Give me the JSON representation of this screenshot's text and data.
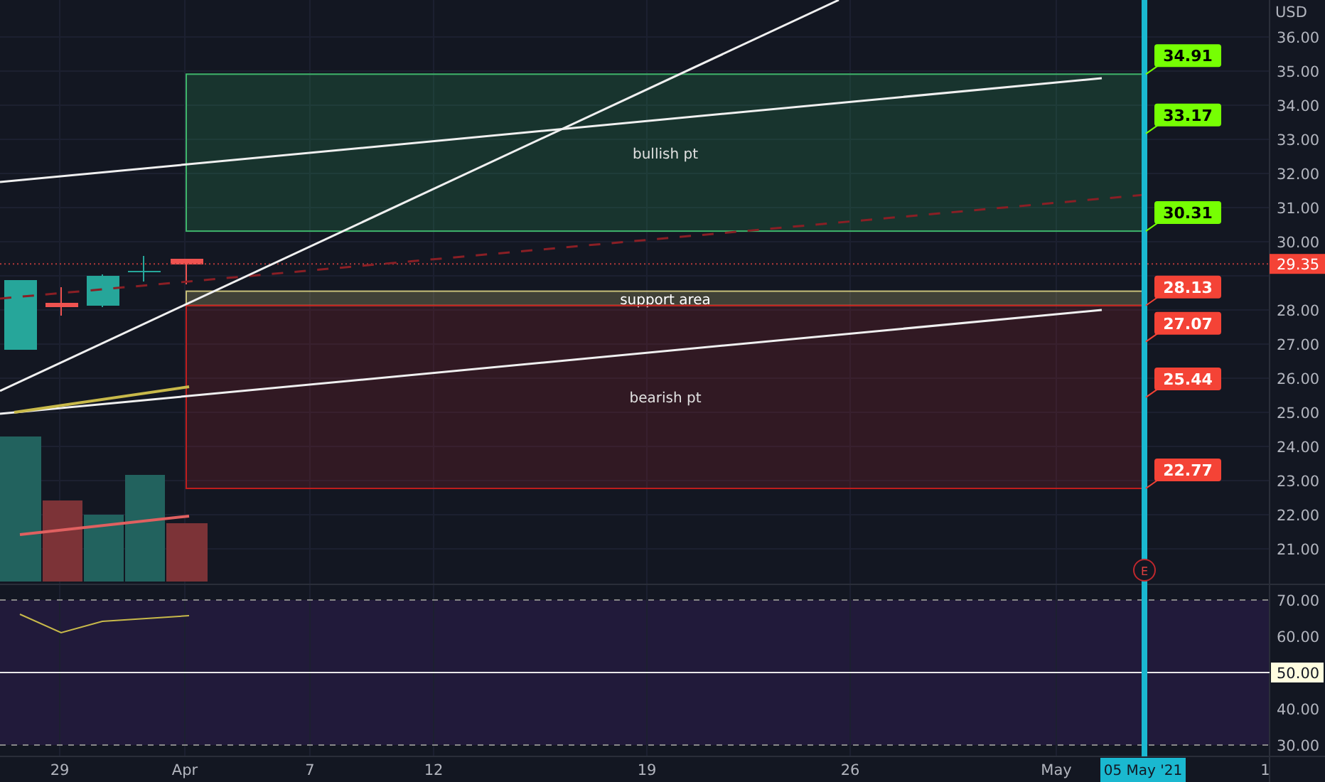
{
  "price_axis": {
    "currency": "USD",
    "ticks": [
      "36.00",
      "35.00",
      "34.00",
      "33.00",
      "32.00",
      "31.00",
      "30.00",
      "28.00",
      "27.00",
      "26.00",
      "25.00",
      "24.00",
      "23.00",
      "22.00",
      "21.00"
    ],
    "last_price": "29.35"
  },
  "zones": [
    {
      "kind": "bullish",
      "label": "bullish pt"
    },
    {
      "kind": "support",
      "label": "support area"
    },
    {
      "kind": "bearish",
      "label": "bearish pt"
    }
  ],
  "targets": [
    {
      "price": "34.91",
      "color": "#76ff03"
    },
    {
      "price": "33.17",
      "color": "#76ff03"
    },
    {
      "price": "30.31",
      "color": "#76ff03"
    },
    {
      "price": "28.13",
      "color": "#f44336"
    },
    {
      "price": "27.07",
      "color": "#f44336"
    },
    {
      "price": "25.44",
      "color": "#f44336"
    },
    {
      "price": "22.77",
      "color": "#f44336"
    }
  ],
  "earnings_marker": "E",
  "rsi_axis": {
    "ticks": [
      "70.00",
      "60.00",
      "40.00",
      "30.00"
    ],
    "midline": "50.00"
  },
  "time_axis": {
    "labels": [
      "29",
      "Apr",
      "7",
      "12",
      "19",
      "26",
      "May",
      "1"
    ],
    "cursor_date": "05 May '21"
  }
}
